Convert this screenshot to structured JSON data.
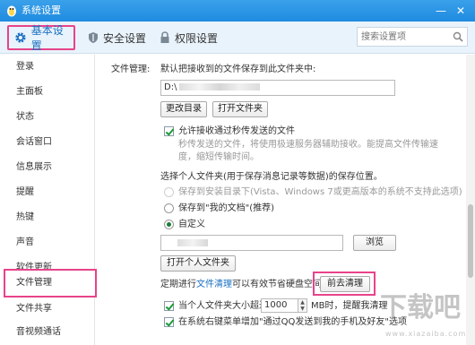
{
  "window": {
    "title": "系统设置"
  },
  "tabs": [
    {
      "label": "基本设置",
      "icon": "gear-icon",
      "active": true
    },
    {
      "label": "安全设置",
      "icon": "shield-icon",
      "active": false
    },
    {
      "label": "权限设置",
      "icon": "lock-icon",
      "active": false
    }
  ],
  "search": {
    "placeholder": "搜索设置项"
  },
  "sidebar": {
    "items": [
      {
        "label": "登录"
      },
      {
        "label": "主面板"
      },
      {
        "label": "状态"
      },
      {
        "label": "会话窗口"
      },
      {
        "label": "信息展示"
      },
      {
        "label": "提醒"
      },
      {
        "label": "热键"
      },
      {
        "label": "声音"
      },
      {
        "label": "软件更新"
      },
      {
        "label": "文件管理",
        "selected": true
      },
      {
        "label": "文件共享"
      },
      {
        "label": "音视频通话"
      }
    ]
  },
  "file_mgmt": {
    "section_label": "文件管理:",
    "default_save_label": "默认把接收到的文件保存到此文件夹中:",
    "path_prefix": "D:\\",
    "change_dir_button": "更改目录",
    "open_folder_button": "打开文件夹",
    "allow_transfer": {
      "label": "允许接收通过秒传发送的文件",
      "checked": true,
      "desc_line1": "秒传发送的文件，将使用极速服务器辅助接收。能提高文件传输速",
      "desc_line2": "度，缩短传输时间。"
    },
    "personal_folder_label": "选择个人文件夹(用于保存消息记录等数据)的保存位置。",
    "options": [
      {
        "label": "保存到安装目录下(Vista、Windows 7或更高版本的系统不支持此选项)",
        "disabled": true,
        "selected": false
      },
      {
        "label": "保存到\"我的文档\"(推荐)",
        "disabled": false,
        "selected": false
      },
      {
        "label": "自定义",
        "disabled": false,
        "selected": true
      }
    ],
    "browse_button": "浏览",
    "open_personal_folder_button": "打开个人文件夹",
    "cleanup": {
      "prefix": "定期进行",
      "link": "文件清理",
      "suffix": "可以有效节省硬盘空间。",
      "button": "前去清理"
    },
    "size_limit": {
      "checked": true,
      "prefix": "当个人文件夹大小超过",
      "value": "1000",
      "suffix": "MB时，提醒我清理"
    },
    "context_menu": {
      "checked": true,
      "label": "在系统右键菜单增加\"通过QQ发送到我的手机及好友\"选项"
    }
  },
  "watermark": {
    "text": "下载吧",
    "sub": "www.xiazaiba.com"
  },
  "colors": {
    "accent": "#1a6fc2",
    "highlight": "#e8438a",
    "titlebar": "#2592e4"
  }
}
